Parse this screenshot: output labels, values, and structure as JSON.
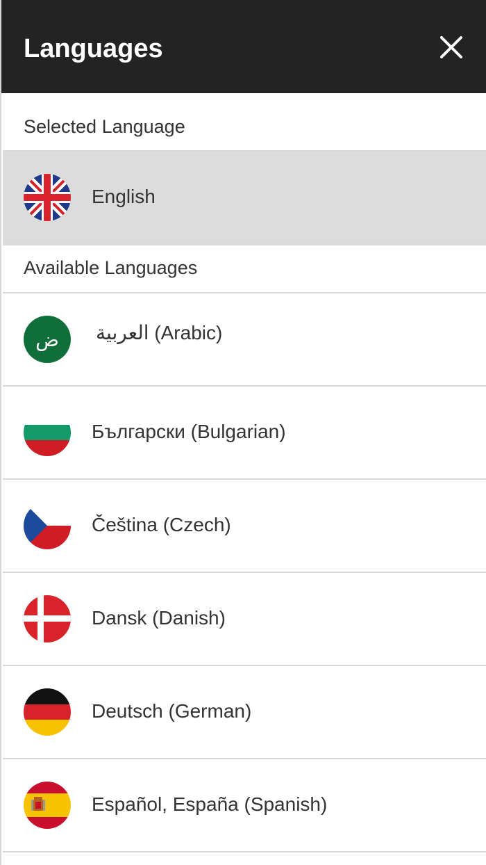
{
  "header": {
    "title": "Languages",
    "close_icon": "close-icon"
  },
  "selected_section": {
    "label": "Selected Language",
    "item": {
      "label": "English",
      "flag": "uk-flag-icon"
    }
  },
  "available_section": {
    "label": "Available Languages",
    "items": [
      {
        "label": "العربية (Arabic)",
        "flag": "arabic-flag-icon",
        "flag_glyph": "ض"
      },
      {
        "label": "Български (Bulgarian)",
        "flag": "bulgaria-flag-icon"
      },
      {
        "label": "Čeština (Czech)",
        "flag": "czech-flag-icon"
      },
      {
        "label": "Dansk (Danish)",
        "flag": "denmark-flag-icon"
      },
      {
        "label": "Deutsch (German)",
        "flag": "germany-flag-icon"
      },
      {
        "label": "Español, España (Spanish)",
        "flag": "spain-flag-icon"
      }
    ]
  },
  "colors": {
    "header_bg": "#232323",
    "selected_bg": "#dcdcdc",
    "divider": "#d9d9d9",
    "text": "#333333"
  }
}
